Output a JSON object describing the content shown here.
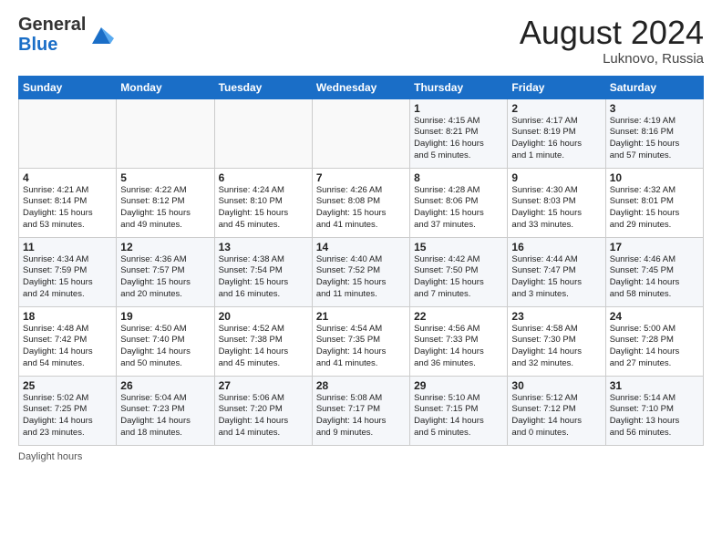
{
  "header": {
    "logo_line1": "General",
    "logo_line2": "Blue",
    "month_title": "August 2024",
    "location": "Luknovo, Russia"
  },
  "days_of_week": [
    "Sunday",
    "Monday",
    "Tuesday",
    "Wednesday",
    "Thursday",
    "Friday",
    "Saturday"
  ],
  "weeks": [
    [
      {
        "day": "",
        "data": ""
      },
      {
        "day": "",
        "data": ""
      },
      {
        "day": "",
        "data": ""
      },
      {
        "day": "",
        "data": ""
      },
      {
        "day": "1",
        "data": "Sunrise: 4:15 AM\nSunset: 8:21 PM\nDaylight: 16 hours\nand 5 minutes."
      },
      {
        "day": "2",
        "data": "Sunrise: 4:17 AM\nSunset: 8:19 PM\nDaylight: 16 hours\nand 1 minute."
      },
      {
        "day": "3",
        "data": "Sunrise: 4:19 AM\nSunset: 8:16 PM\nDaylight: 15 hours\nand 57 minutes."
      }
    ],
    [
      {
        "day": "4",
        "data": "Sunrise: 4:21 AM\nSunset: 8:14 PM\nDaylight: 15 hours\nand 53 minutes."
      },
      {
        "day": "5",
        "data": "Sunrise: 4:22 AM\nSunset: 8:12 PM\nDaylight: 15 hours\nand 49 minutes."
      },
      {
        "day": "6",
        "data": "Sunrise: 4:24 AM\nSunset: 8:10 PM\nDaylight: 15 hours\nand 45 minutes."
      },
      {
        "day": "7",
        "data": "Sunrise: 4:26 AM\nSunset: 8:08 PM\nDaylight: 15 hours\nand 41 minutes."
      },
      {
        "day": "8",
        "data": "Sunrise: 4:28 AM\nSunset: 8:06 PM\nDaylight: 15 hours\nand 37 minutes."
      },
      {
        "day": "9",
        "data": "Sunrise: 4:30 AM\nSunset: 8:03 PM\nDaylight: 15 hours\nand 33 minutes."
      },
      {
        "day": "10",
        "data": "Sunrise: 4:32 AM\nSunset: 8:01 PM\nDaylight: 15 hours\nand 29 minutes."
      }
    ],
    [
      {
        "day": "11",
        "data": "Sunrise: 4:34 AM\nSunset: 7:59 PM\nDaylight: 15 hours\nand 24 minutes."
      },
      {
        "day": "12",
        "data": "Sunrise: 4:36 AM\nSunset: 7:57 PM\nDaylight: 15 hours\nand 20 minutes."
      },
      {
        "day": "13",
        "data": "Sunrise: 4:38 AM\nSunset: 7:54 PM\nDaylight: 15 hours\nand 16 minutes."
      },
      {
        "day": "14",
        "data": "Sunrise: 4:40 AM\nSunset: 7:52 PM\nDaylight: 15 hours\nand 11 minutes."
      },
      {
        "day": "15",
        "data": "Sunrise: 4:42 AM\nSunset: 7:50 PM\nDaylight: 15 hours\nand 7 minutes."
      },
      {
        "day": "16",
        "data": "Sunrise: 4:44 AM\nSunset: 7:47 PM\nDaylight: 15 hours\nand 3 minutes."
      },
      {
        "day": "17",
        "data": "Sunrise: 4:46 AM\nSunset: 7:45 PM\nDaylight: 14 hours\nand 58 minutes."
      }
    ],
    [
      {
        "day": "18",
        "data": "Sunrise: 4:48 AM\nSunset: 7:42 PM\nDaylight: 14 hours\nand 54 minutes."
      },
      {
        "day": "19",
        "data": "Sunrise: 4:50 AM\nSunset: 7:40 PM\nDaylight: 14 hours\nand 50 minutes."
      },
      {
        "day": "20",
        "data": "Sunrise: 4:52 AM\nSunset: 7:38 PM\nDaylight: 14 hours\nand 45 minutes."
      },
      {
        "day": "21",
        "data": "Sunrise: 4:54 AM\nSunset: 7:35 PM\nDaylight: 14 hours\nand 41 minutes."
      },
      {
        "day": "22",
        "data": "Sunrise: 4:56 AM\nSunset: 7:33 PM\nDaylight: 14 hours\nand 36 minutes."
      },
      {
        "day": "23",
        "data": "Sunrise: 4:58 AM\nSunset: 7:30 PM\nDaylight: 14 hours\nand 32 minutes."
      },
      {
        "day": "24",
        "data": "Sunrise: 5:00 AM\nSunset: 7:28 PM\nDaylight: 14 hours\nand 27 minutes."
      }
    ],
    [
      {
        "day": "25",
        "data": "Sunrise: 5:02 AM\nSunset: 7:25 PM\nDaylight: 14 hours\nand 23 minutes."
      },
      {
        "day": "26",
        "data": "Sunrise: 5:04 AM\nSunset: 7:23 PM\nDaylight: 14 hours\nand 18 minutes."
      },
      {
        "day": "27",
        "data": "Sunrise: 5:06 AM\nSunset: 7:20 PM\nDaylight: 14 hours\nand 14 minutes."
      },
      {
        "day": "28",
        "data": "Sunrise: 5:08 AM\nSunset: 7:17 PM\nDaylight: 14 hours\nand 9 minutes."
      },
      {
        "day": "29",
        "data": "Sunrise: 5:10 AM\nSunset: 7:15 PM\nDaylight: 14 hours\nand 5 minutes."
      },
      {
        "day": "30",
        "data": "Sunrise: 5:12 AM\nSunset: 7:12 PM\nDaylight: 14 hours\nand 0 minutes."
      },
      {
        "day": "31",
        "data": "Sunrise: 5:14 AM\nSunset: 7:10 PM\nDaylight: 13 hours\nand 56 minutes."
      }
    ]
  ],
  "footer": {
    "daylight_label": "Daylight hours"
  }
}
